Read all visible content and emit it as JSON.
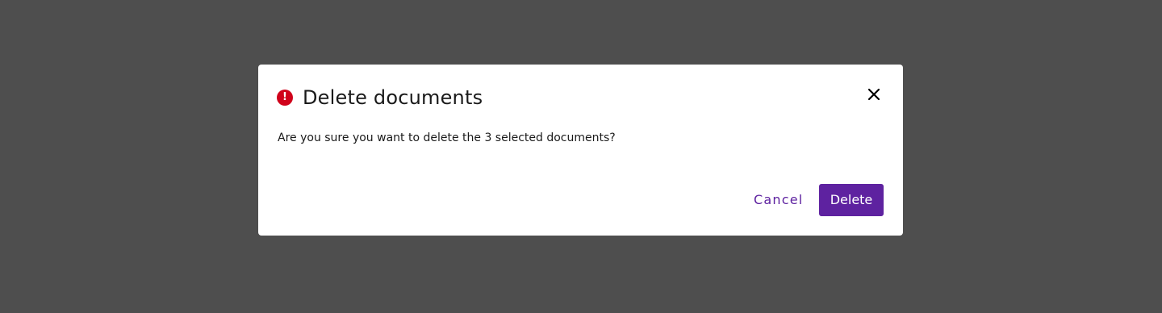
{
  "dialog": {
    "title": "Delete documents",
    "message": "Are you sure you want to delete the 3 selected documents?",
    "icons": {
      "alert": "alert-circle-icon",
      "close": "close-icon"
    },
    "alert_symbol": "!",
    "buttons": {
      "cancel_label": "Cancel",
      "delete_label": "Delete"
    }
  },
  "colors": {
    "backdrop": "#4e4e4e",
    "alert": "#d0021b",
    "primary": "#5e22a0",
    "text": "#1a1a1a"
  }
}
